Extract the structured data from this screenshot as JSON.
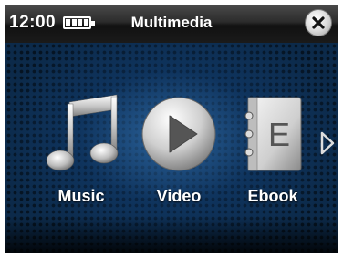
{
  "status": {
    "time": "12:00"
  },
  "header": {
    "title": "Multimedia"
  },
  "menu": {
    "items": [
      {
        "label": "Music",
        "icon": "music-icon"
      },
      {
        "label": "Video",
        "icon": "play-icon"
      },
      {
        "label": "Ebook",
        "icon": "ebook-icon",
        "icon_letter": "E"
      }
    ]
  },
  "colors": {
    "background": "#0c2a4a",
    "accent_glow": "#3c82c8",
    "text": "#ffffff"
  }
}
